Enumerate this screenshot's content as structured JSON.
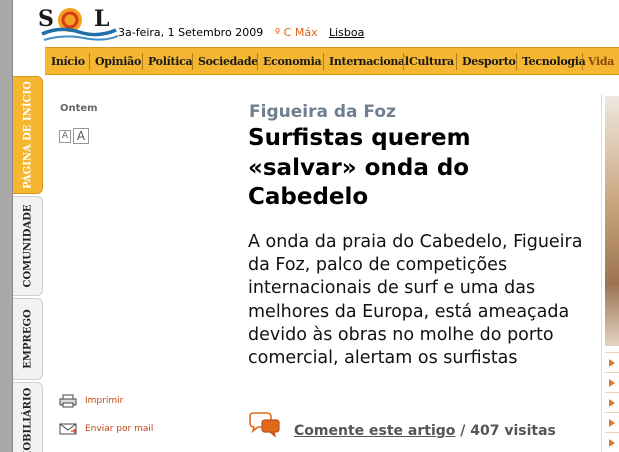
{
  "header": {
    "date": "3a-feira, 1 Setembro 2009",
    "temperature": "º C Máx",
    "city": "Lisboa"
  },
  "nav": {
    "items": [
      "Início",
      "Opinião",
      "Política",
      "Sociedade",
      "Economia",
      "Internacional",
      "Cultura",
      "Desporto",
      "Tecnologia",
      "Vida"
    ]
  },
  "side_tabs": [
    "PÁGINA DE INÍCIO",
    "COMUNIDADE",
    "EMPREGO",
    "IMOBILIÁRIO"
  ],
  "left_column": {
    "ontem": "Ontem",
    "font_small": "A",
    "font_large": "A",
    "print": "Imprimir",
    "email": "Enviar por mail"
  },
  "article": {
    "kicker": "Figueira da Foz",
    "headline": "Surfistas querem «salvar» onda do Cabedelo",
    "lead": "A onda da praia do Cabedelo, Figueira da Foz, palco de competições internacionais de surf e uma das melhores da Europa, está ameaçada devido às obras no molhe do porto comercial, alertam os surfistas",
    "comment_link": "Comente este artigo",
    "visits": " / 407 visitas"
  },
  "colors": {
    "nav_bg": "#f5b731",
    "accent": "#e8600c",
    "kicker": "#6f7f8f"
  }
}
